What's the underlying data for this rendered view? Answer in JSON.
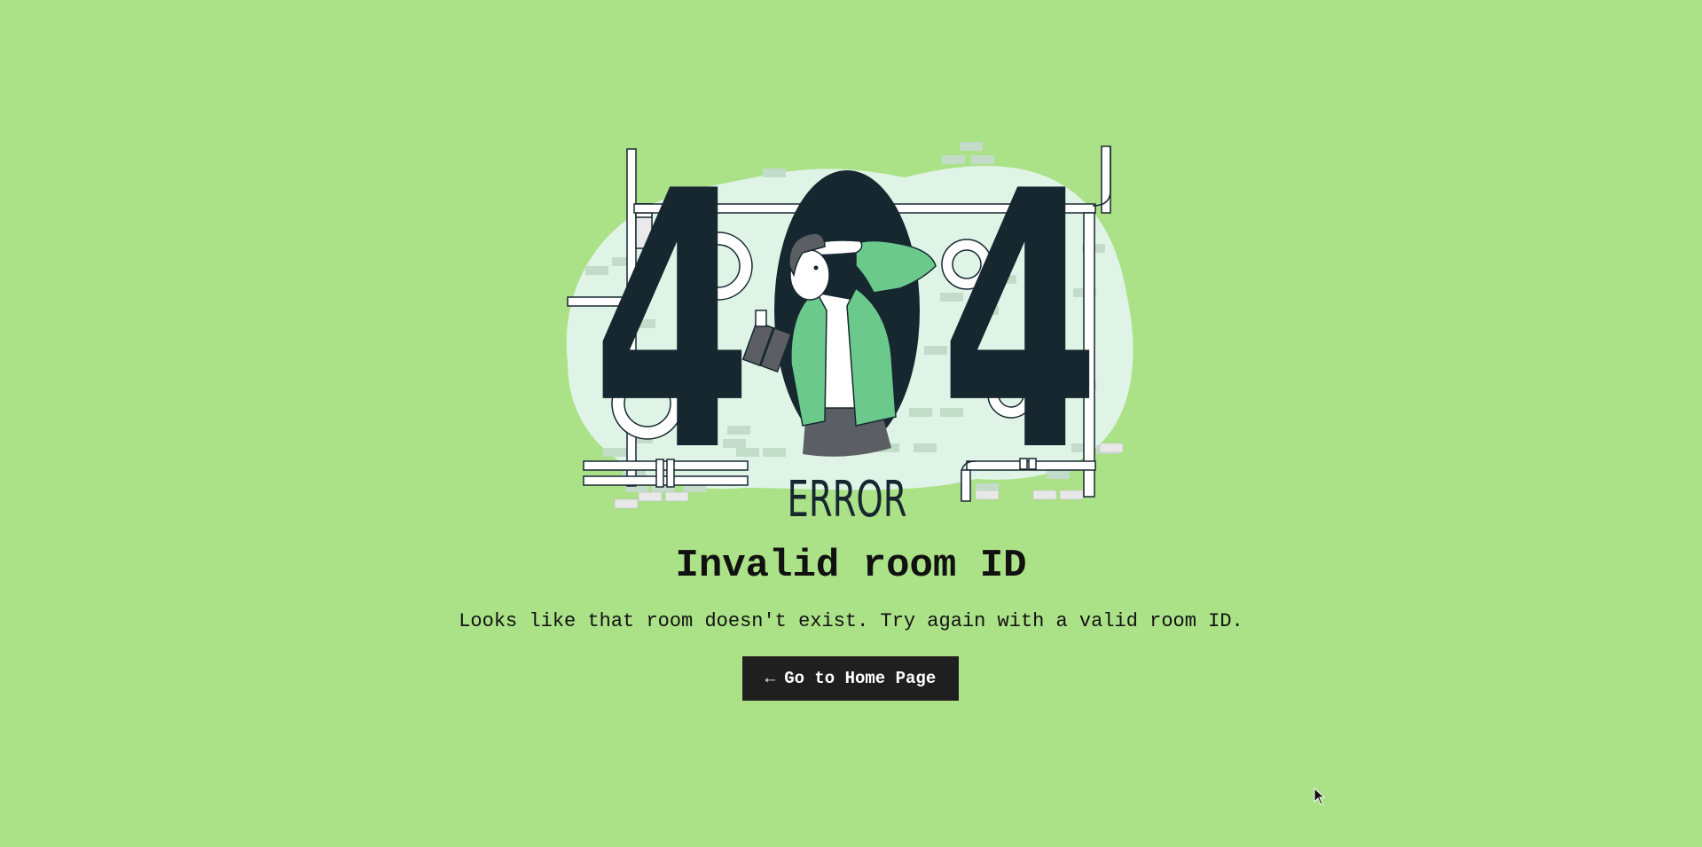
{
  "illustration": {
    "big_text_left": "4",
    "big_text_right": "4",
    "error_label": "ERROR"
  },
  "error": {
    "title": "Invalid room ID",
    "message": "Looks like that room doesn't exist. Try again with a valid room ID."
  },
  "home_button": {
    "arrow": "←",
    "label": "Go to Home Page"
  },
  "colors": {
    "background": "#abe187",
    "blob": "#dff4e6",
    "digits": "#172730",
    "jacket": "#6cc98c",
    "button": "#1f1f1f"
  }
}
